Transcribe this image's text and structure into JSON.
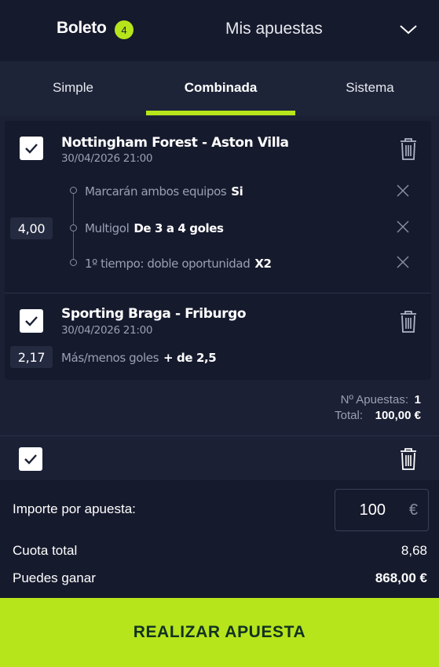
{
  "header": {
    "title": "Boleto",
    "badge_count": "4",
    "my_bets_label": "Mis apuestas"
  },
  "tabs": [
    {
      "label": "Simple",
      "active": false
    },
    {
      "label": "Combinada",
      "active": true
    },
    {
      "label": "Sistema",
      "active": false
    }
  ],
  "bets": [
    {
      "event": "Nottingham Forest - Aston Villa",
      "datetime": "30/04/2026 21:00",
      "odds": "4,00",
      "checked": true,
      "selections": [
        {
          "market": "Marcarán ambos equipos",
          "pick": "Si"
        },
        {
          "market": "Multigol",
          "pick": "De 3 a 4 goles"
        },
        {
          "market": "1º tiempo: doble oportunidad",
          "pick": "X2"
        }
      ]
    },
    {
      "event": "Sporting Braga - Friburgo",
      "datetime": "30/04/2026 21:00",
      "odds": "2,17",
      "checked": true,
      "selections": [
        {
          "market": "Más/menos goles",
          "pick": "+ de 2,5"
        }
      ]
    }
  ],
  "summary": {
    "num_bets_label": "Nº Apuestas:",
    "num_bets_value": "1",
    "total_label": "Total:",
    "total_value": "100,00 €"
  },
  "stake": {
    "label": "Importe por apuesta:",
    "value": "100",
    "currency": "€"
  },
  "totals": {
    "odds_label": "Cuota total",
    "odds_value": "8,68",
    "win_label": "Puedes ganar",
    "win_value": "868,00 €"
  },
  "cta_label": "REALIZAR APUESTA",
  "colors": {
    "accent": "#b6e51c",
    "background": "#1b2035",
    "panel": "#161a2d",
    "cta_text": "#123222"
  }
}
